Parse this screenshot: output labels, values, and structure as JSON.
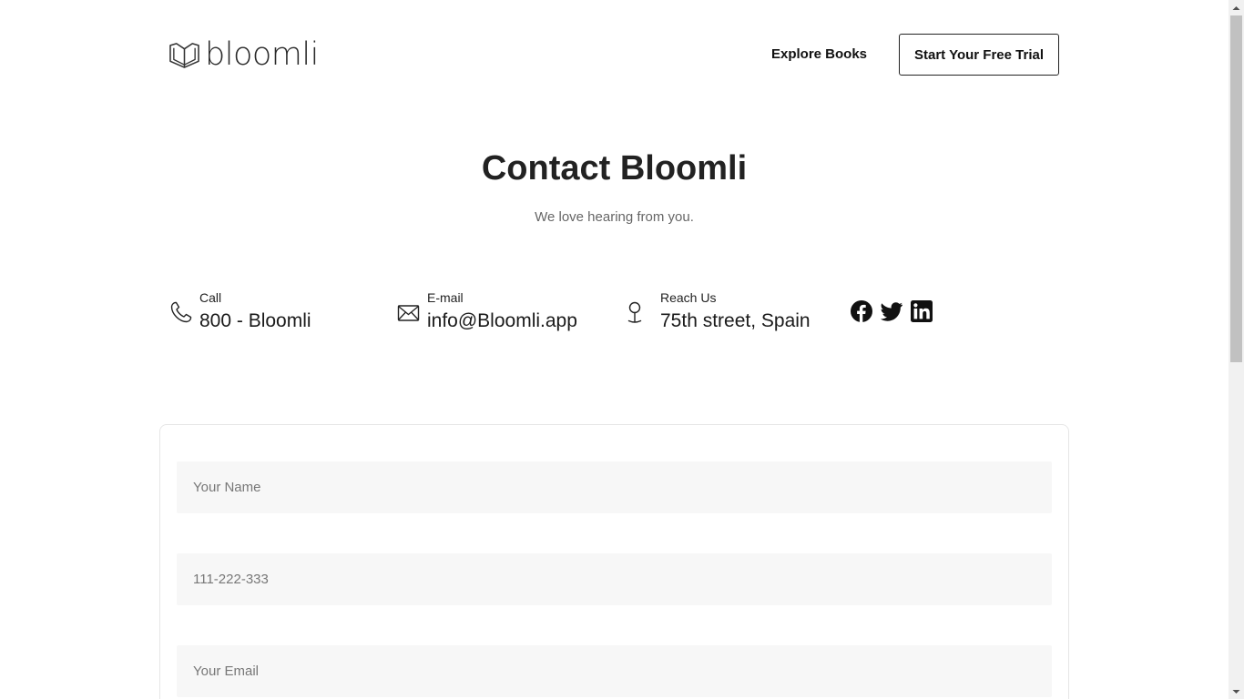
{
  "header": {
    "logo_text": "bloomli",
    "nav_link": "Explore Books",
    "cta_label": "Start Your Free Trial"
  },
  "hero": {
    "title": "Contact Bloomli",
    "subtitle": "We love hearing from you."
  },
  "contact": [
    {
      "label": "Call",
      "value": "800 - Bloomli",
      "icon": "phone-icon"
    },
    {
      "label": "E-mail",
      "value": "info@Bloomli.app",
      "icon": "mail-icon"
    },
    {
      "label": "Reach Us",
      "value": "75th street, Spain",
      "icon": "location-pin-icon"
    }
  ],
  "social": [
    "facebook-icon",
    "twitter-icon",
    "linkedin-icon"
  ],
  "form": {
    "name_placeholder": "Your Name",
    "phone_placeholder": "111-222-333",
    "email_placeholder": "Your Email"
  },
  "colors": {
    "text": "#1a1a1a",
    "muted": "#666666",
    "field_bg": "#f7f7f7",
    "card_border": "#e6e6e6"
  }
}
